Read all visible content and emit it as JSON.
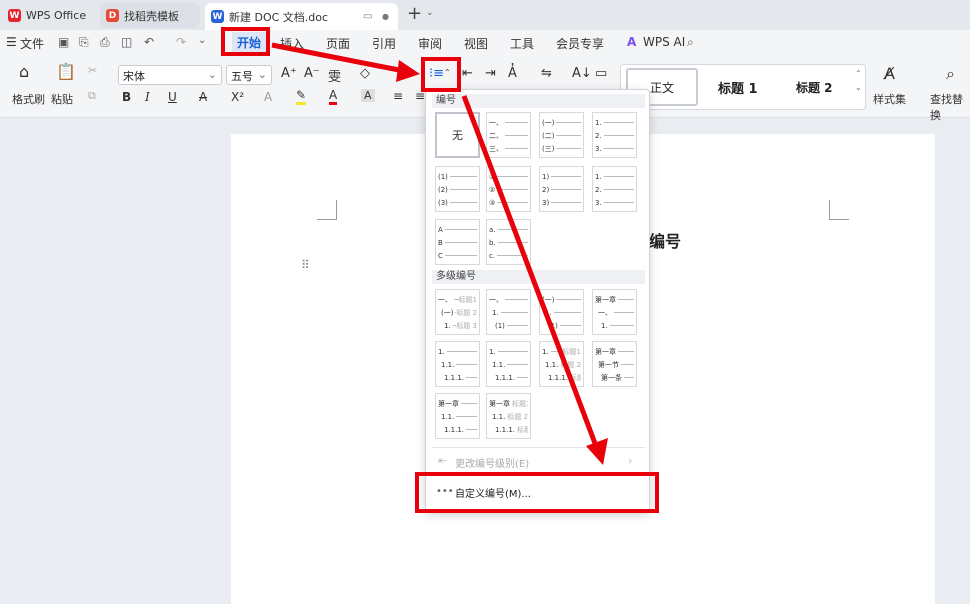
{
  "window_tabs": [
    {
      "label": "WPS Office",
      "icon": "wps-logo-icon"
    },
    {
      "label": "找稻壳模板",
      "icon": "docer-icon"
    },
    {
      "label": "新建 DOC 文档.doc",
      "icon": "word-doc-icon"
    }
  ],
  "menu": {
    "file": "文件",
    "tabs": [
      "开始",
      "插入",
      "页面",
      "引用",
      "审阅",
      "视图",
      "工具",
      "会员专享"
    ],
    "ai": "WPS AI"
  },
  "ribbon": {
    "format_painter": "格式刷",
    "paste": "粘贴",
    "font_name": "宋体",
    "font_size": "五号",
    "style_normal": "正文",
    "style_h1": "标题 1",
    "style_h2": "标题 2",
    "styles_set": "样式集",
    "find_replace": "查找替换"
  },
  "doc": {
    "heading_fragment": "编号"
  },
  "dropdown": {
    "section_numbering": "编号",
    "none_label": "无",
    "single_tiles": [
      [
        "一、",
        "二、",
        "三、"
      ],
      [
        "(一)",
        "(二)",
        "(三)"
      ],
      [
        "1.",
        "2.",
        "3."
      ],
      [
        "(1)",
        "(2)",
        "(3)"
      ],
      [
        "①",
        "②",
        "③"
      ],
      [
        "1)",
        "2)",
        "3)"
      ],
      [
        "1.",
        "2.",
        "3."
      ],
      [
        "A",
        "B",
        "C"
      ],
      [
        "a.",
        "b.",
        "c."
      ]
    ],
    "section_multilevel": "多级编号",
    "multi_tiles": [
      [
        [
          "一、",
          "标题1"
        ],
        [
          "(一)",
          "标题 2"
        ],
        [
          "1.",
          "标题 3"
        ]
      ],
      [
        [
          "一、",
          ""
        ],
        [
          "1.",
          ""
        ],
        [
          "(1)",
          ""
        ]
      ],
      [
        [
          "(一)",
          ""
        ],
        [
          "1.",
          ""
        ],
        [
          "(1)",
          ""
        ]
      ],
      [
        [
          "第一章",
          ""
        ],
        [
          "一、",
          ""
        ],
        [
          "1.",
          ""
        ]
      ],
      [
        [
          "1.",
          ""
        ],
        [
          "1.1.",
          ""
        ],
        [
          "1.1.1.",
          ""
        ]
      ],
      [
        [
          "1.",
          ""
        ],
        [
          "1.1.",
          ""
        ],
        [
          "1.1.1.",
          ""
        ]
      ],
      [
        [
          "1.",
          "标题1"
        ],
        [
          "1.1.",
          "标题 2"
        ],
        [
          "1.1.1.",
          "标题 3"
        ]
      ],
      [
        [
          "第一章",
          ""
        ],
        [
          "第一节",
          ""
        ],
        [
          "第一条",
          ""
        ]
      ],
      [
        [
          "第一章",
          ""
        ],
        [
          "1.1.",
          ""
        ],
        [
          "1.1.1.",
          ""
        ]
      ],
      [
        [
          "第一章",
          "标题1"
        ],
        [
          "1.1.",
          "标题 2"
        ],
        [
          "1.1.1.",
          "标题 3"
        ]
      ]
    ],
    "change_level": "更改编号级别(E)",
    "custom": "自定义编号(M)..."
  },
  "colors": {
    "annotation": "#e8000b",
    "accent": "#1a5fd6"
  }
}
